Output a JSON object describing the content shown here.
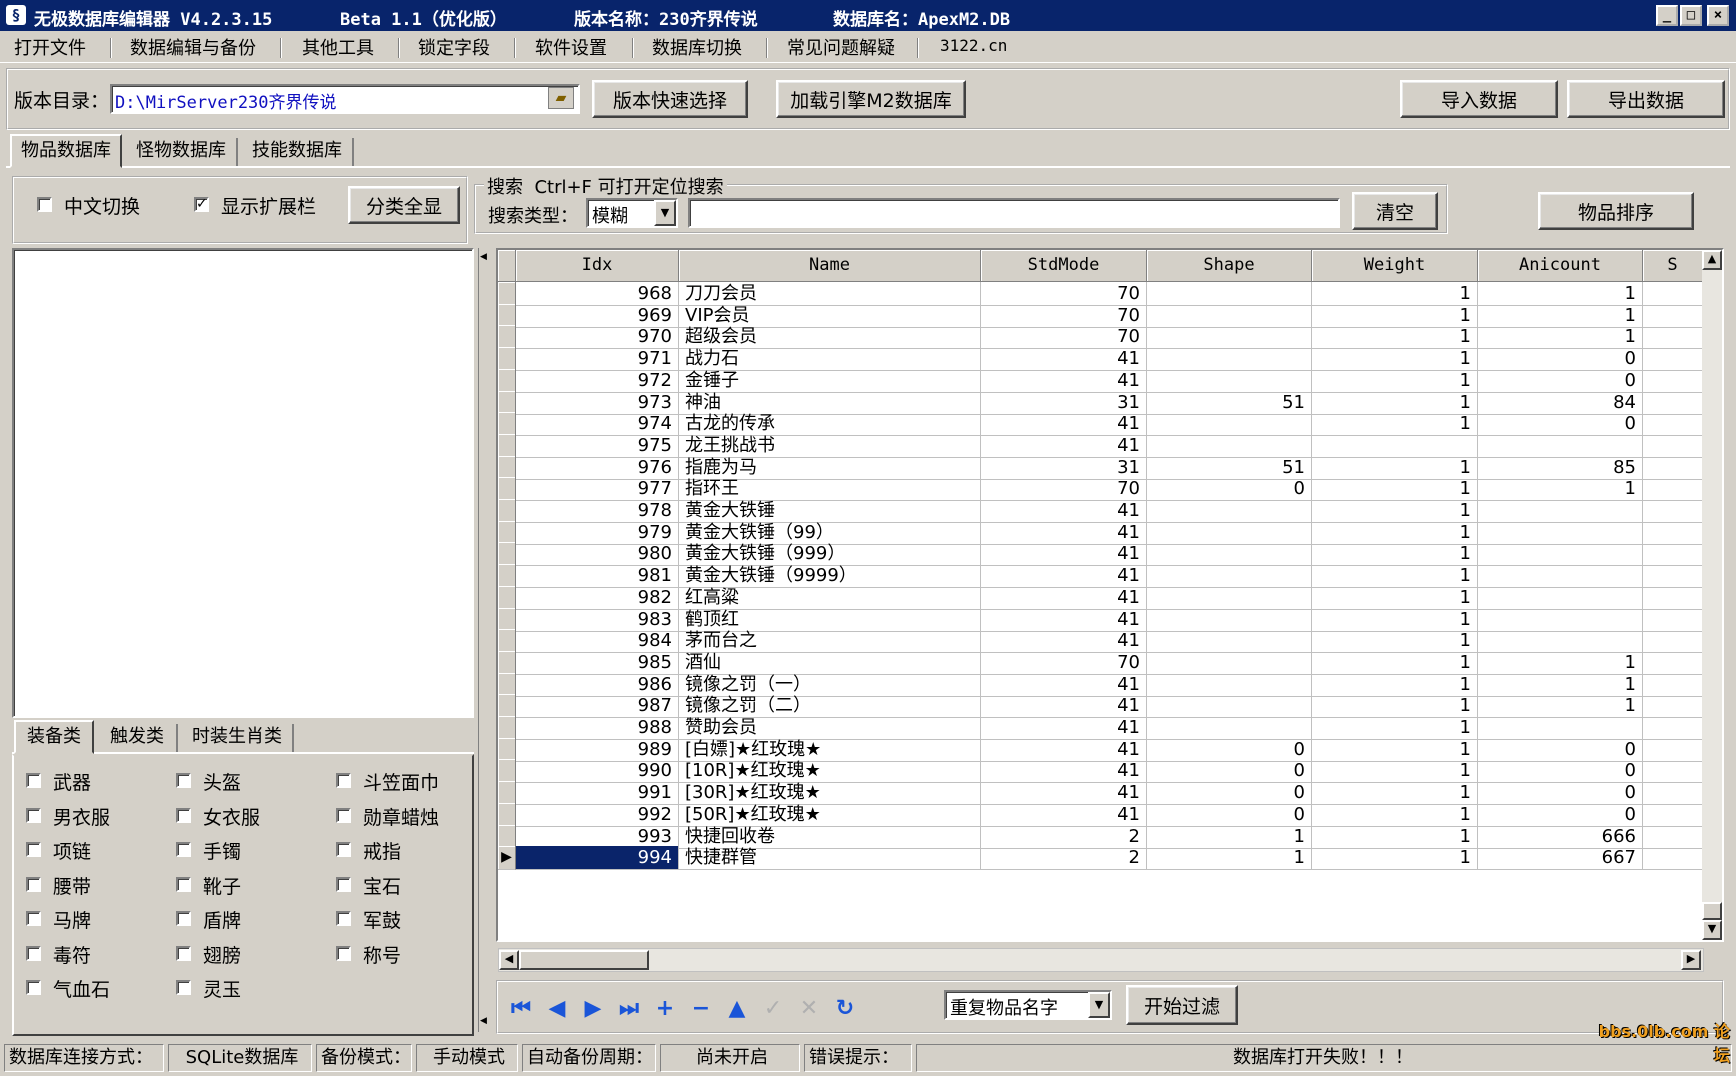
{
  "window": {
    "title_app": "无极数据库编辑器 V4.2.3.15",
    "title_beta": "Beta 1.1（优化版）",
    "title_version": "版本名称：230齐界传说",
    "title_db": "数据库名：ApexM2.DB",
    "icon": "app-icon"
  },
  "menu": [
    "打开文件",
    "数据编辑与备份",
    "其他工具",
    "锁定字段",
    "软件设置",
    "数据库切换",
    "常见问题解疑",
    "3122.cn"
  ],
  "toolbar": {
    "dir_label": "版本目录：",
    "dir_value": "D:\\MirServer230齐界传说",
    "quick_select": "版本快速选择",
    "load_engine": "加载引擎M2数据库",
    "import": "导入数据",
    "export": "导出数据"
  },
  "tabs": [
    "物品数据库",
    "怪物数据库",
    "技能数据库"
  ],
  "options": {
    "chinese_toggle": "中文切换",
    "chinese_checked": false,
    "show_ext": "显示扩展栏",
    "show_ext_checked": true,
    "show_all_categories": "分类全显"
  },
  "search": {
    "group_title": "搜索  Ctrl+F 可打开定位搜索",
    "type_label": "搜索类型：",
    "type_value": "模糊",
    "query": "",
    "clear": "清空",
    "sort": "物品排序"
  },
  "category_tabs": [
    "装备类",
    "触发类",
    "时装生肖类"
  ],
  "categories": [
    [
      "武器",
      "头盔",
      "斗笠面巾"
    ],
    [
      "男衣服",
      "女衣服",
      "勋章蜡烛"
    ],
    [
      "项链",
      "手镯",
      "戒指"
    ],
    [
      "腰带",
      "靴子",
      "宝石"
    ],
    [
      "马牌",
      "盾牌",
      "军鼓"
    ],
    [
      "毒符",
      "翅膀",
      "称号"
    ],
    [
      "气血石",
      "灵玉",
      ""
    ]
  ],
  "table": {
    "columns": [
      "Idx",
      "Name",
      "StdMode",
      "Shape",
      "Weight",
      "Anicount",
      "S"
    ],
    "rows": [
      [
        "968",
        "刀刀会员",
        "70",
        "",
        "1",
        "1"
      ],
      [
        "969",
        "VIP会员",
        "70",
        "",
        "1",
        "1"
      ],
      [
        "970",
        "超级会员",
        "70",
        "",
        "1",
        "1"
      ],
      [
        "971",
        "战力石",
        "41",
        "",
        "1",
        "0"
      ],
      [
        "972",
        "金锤子",
        "41",
        "",
        "1",
        "0"
      ],
      [
        "973",
        "神油",
        "31",
        "51",
        "1",
        "84"
      ],
      [
        "974",
        "古龙的传承",
        "41",
        "",
        "1",
        "0"
      ],
      [
        "975",
        "龙王挑战书",
        "41",
        "",
        "",
        ""
      ],
      [
        "976",
        "指鹿为马",
        "31",
        "51",
        "1",
        "85"
      ],
      [
        "977",
        "指环王",
        "70",
        "0",
        "1",
        "1"
      ],
      [
        "978",
        "黄金大铁锤",
        "41",
        "",
        "1",
        ""
      ],
      [
        "979",
        "黄金大铁锤（99）",
        "41",
        "",
        "1",
        ""
      ],
      [
        "980",
        "黄金大铁锤（999）",
        "41",
        "",
        "1",
        ""
      ],
      [
        "981",
        "黄金大铁锤（9999）",
        "41",
        "",
        "1",
        ""
      ],
      [
        "982",
        "红高粱",
        "41",
        "",
        "1",
        ""
      ],
      [
        "983",
        "鹤顶红",
        "41",
        "",
        "1",
        ""
      ],
      [
        "984",
        "茅而台之",
        "41",
        "",
        "1",
        ""
      ],
      [
        "985",
        "酒仙",
        "70",
        "",
        "1",
        "1"
      ],
      [
        "986",
        "镜像之罚（一）",
        "41",
        "",
        "1",
        "1"
      ],
      [
        "987",
        "镜像之罚（二）",
        "41",
        "",
        "1",
        "1"
      ],
      [
        "988",
        "赞助会员",
        "41",
        "",
        "1",
        ""
      ],
      [
        "989",
        "[白嫖]★红玫瑰★",
        "41",
        "0",
        "1",
        "0"
      ],
      [
        "990",
        "[10R]★红玫瑰★",
        "41",
        "0",
        "1",
        "0"
      ],
      [
        "991",
        "[30R]★红玫瑰★",
        "41",
        "0",
        "1",
        "0"
      ],
      [
        "992",
        "[50R]★红玫瑰★",
        "41",
        "0",
        "1",
        "0"
      ],
      [
        "993",
        "快捷回收卷",
        "2",
        "1",
        "1",
        "666"
      ],
      [
        "994",
        "快捷群管",
        "2",
        "1",
        "1",
        "667"
      ]
    ],
    "selected_idx": "994"
  },
  "nav": [
    "first-icon",
    "prev-icon",
    "next-icon",
    "last-icon",
    "insert-icon",
    "delete-icon",
    "edit-icon",
    "post-icon",
    "cancel-icon",
    "refresh-icon"
  ],
  "filter": {
    "select_value": "重复物品名字",
    "start": "开始过滤"
  },
  "status": {
    "conn_label": "数据库连接方式：",
    "conn_value": "SQLite数据库",
    "backup_label": "备份模式：",
    "backup_value": "手动模式",
    "auto_label": "自动备份周期：",
    "auto_value": "尚未开启",
    "error_label": "错误提示：",
    "error_value": "数据库打开失败！！！"
  },
  "watermark": "bbs.0lb.com 论坛"
}
